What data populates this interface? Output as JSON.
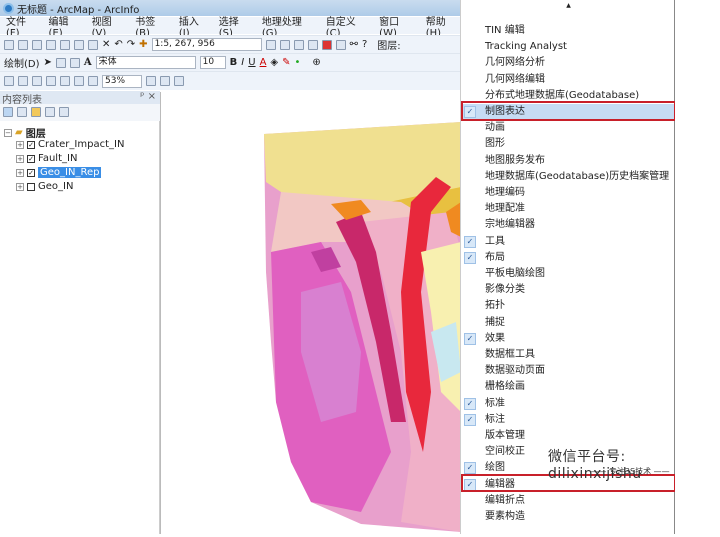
{
  "window": {
    "title": "无标题 - ArcMap - ArcInfo"
  },
  "menubar": [
    "文件(F)",
    "编辑(E)",
    "视图(V)",
    "书签(B)",
    "插入(I)",
    "选择(S)",
    "地理处理(G)",
    "自定义(C)",
    "窗口(W)",
    "帮助(H)"
  ],
  "toolbar": {
    "scale": "1:5, 267, 956",
    "layers_label": "图层:",
    "draw_label": "绘制(D)",
    "font": "宋体",
    "font_size": "10",
    "zoom": "53%",
    "bold": "B",
    "italic": "I",
    "underline": "U",
    "text_a": "A"
  },
  "toc": {
    "title": "内容列表",
    "root": "图层",
    "layers": [
      {
        "name": "Crater_Impact_IN",
        "checked": true,
        "selected": false
      },
      {
        "name": "Fault_IN",
        "checked": true,
        "selected": false
      },
      {
        "name": "Geo_IN_Rep",
        "checked": true,
        "selected": true
      },
      {
        "name": "Geo_IN",
        "checked": false,
        "selected": false
      }
    ]
  },
  "menu": {
    "scroll_up": "▲",
    "items": [
      {
        "label": "TIN 编辑",
        "checked": false
      },
      {
        "label": "Tracking Analyst",
        "checked": false
      },
      {
        "label": "几何网络分析",
        "checked": false
      },
      {
        "label": "几何网络编辑",
        "checked": false
      },
      {
        "label": "分布式地理数据库(Geodatabase)",
        "checked": false
      },
      {
        "label": "制图表达",
        "checked": true,
        "highlighted": true
      },
      {
        "label": "动画",
        "checked": false
      },
      {
        "label": "图形",
        "checked": false
      },
      {
        "label": "地图服务发布",
        "checked": false
      },
      {
        "label": "地理数据库(Geodatabase)历史档案管理",
        "checked": false
      },
      {
        "label": "地理编码",
        "checked": false
      },
      {
        "label": "地理配准",
        "checked": false
      },
      {
        "label": "宗地编辑器",
        "checked": false
      },
      {
        "label": "工具",
        "checked": true
      },
      {
        "label": "布局",
        "checked": true
      },
      {
        "label": "平板电脑绘图",
        "checked": false
      },
      {
        "label": "影像分类",
        "checked": false
      },
      {
        "label": "拓扑",
        "checked": false
      },
      {
        "label": "捕捉",
        "checked": false
      },
      {
        "label": "效果",
        "checked": true
      },
      {
        "label": "数据框工具",
        "checked": false
      },
      {
        "label": "数据驱动页面",
        "checked": false
      },
      {
        "label": "栅格绘画",
        "checked": false
      },
      {
        "label": "标准",
        "checked": true
      },
      {
        "label": "标注",
        "checked": true
      },
      {
        "label": "版本管理",
        "checked": false
      },
      {
        "label": "空间校正",
        "checked": false
      },
      {
        "label": "绘图",
        "checked": true
      },
      {
        "label": "编辑器",
        "checked": true
      },
      {
        "label": "编辑折点",
        "checked": false
      },
      {
        "label": "要素构造",
        "checked": false
      }
    ]
  },
  "watermark": {
    "line1": "微信平台号: dilixinxijishu",
    "line2": "专注3S技术"
  },
  "colors": {
    "highlight": "#c6dcf4",
    "redbox": "#c8202a",
    "selection": "#3a8ee6"
  }
}
